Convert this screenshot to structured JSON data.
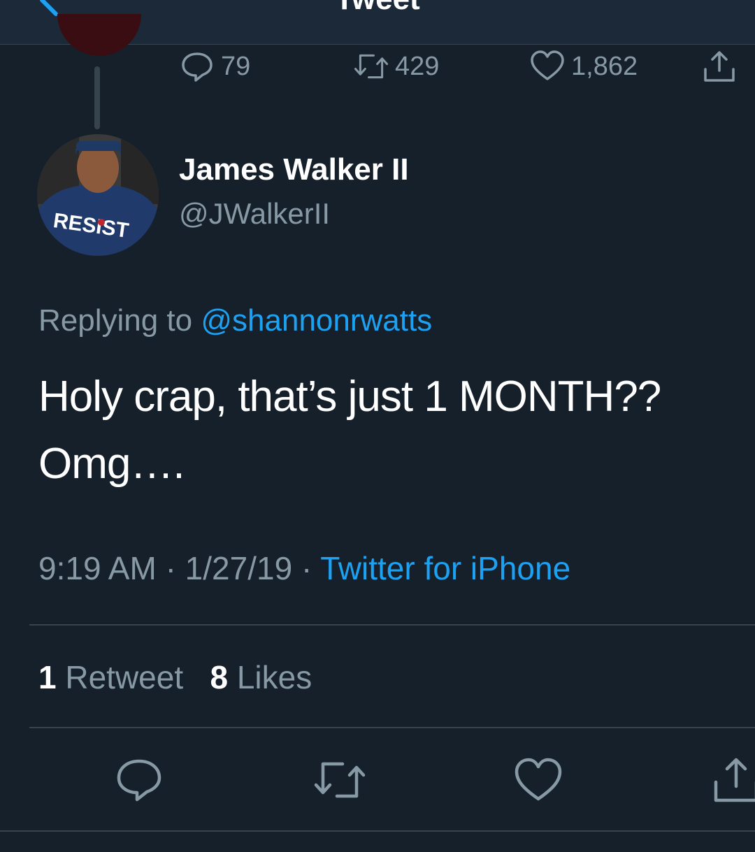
{
  "header": {
    "title": "Tweet"
  },
  "parent_tweet": {
    "reply_count": "79",
    "retweet_count": "429",
    "like_count": "1,862"
  },
  "tweet": {
    "author_name": "James Walker II",
    "author_handle": "@JWalkerII",
    "avatar_shirt_text": "RESIST",
    "replying_prefix": "Replying to",
    "replying_to": "@shannonrwatts",
    "text_line1": "Holy crap, that’s just 1 MONTH??",
    "text_line2": "Omg….",
    "time": "9:19 AM",
    "separator": "·",
    "date": "1/27/19",
    "source": "Twitter for iPhone"
  },
  "stats": {
    "retweet_count": "1",
    "retweet_label": "Retweet",
    "like_count": "8",
    "like_label": "Likes"
  },
  "colors": {
    "background": "#15202b",
    "header": "#1c2938",
    "accent": "#1da1f2",
    "secondary_text": "#8899a6",
    "divider": "#38444d"
  },
  "icons": [
    "back-chevron-icon",
    "reply-icon",
    "retweet-icon",
    "like-icon",
    "share-icon"
  ]
}
